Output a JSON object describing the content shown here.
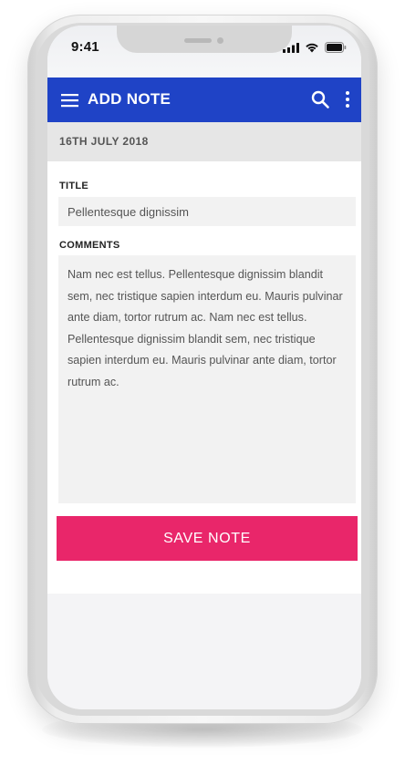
{
  "status": {
    "time": "9:41"
  },
  "app_bar": {
    "title": "ADD NOTE",
    "background_color": "#1f43c6",
    "menu_icon": "hamburger-menu-icon",
    "search_icon": "search-icon",
    "more_icon": "more-vertical-icon"
  },
  "note": {
    "date": "16TH JULY 2018",
    "title_label": "TITLE",
    "title_value": "Pellentesque dignissim",
    "comments_label": "COMMENTS",
    "comments_value": "Nam nec est tellus. Pellentesque dignissim blandit sem, nec tristique sapien interdum eu. Mauris pulvinar ante diam, tortor rutrum ac. Nam nec est tellus. Pellentesque dignissim blandit sem, nec tristique sapien interdum eu. Mauris pulvinar ante diam, tortor rutrum ac."
  },
  "actions": {
    "save_label": "SAVE NOTE",
    "save_color": "#e9266a"
  }
}
